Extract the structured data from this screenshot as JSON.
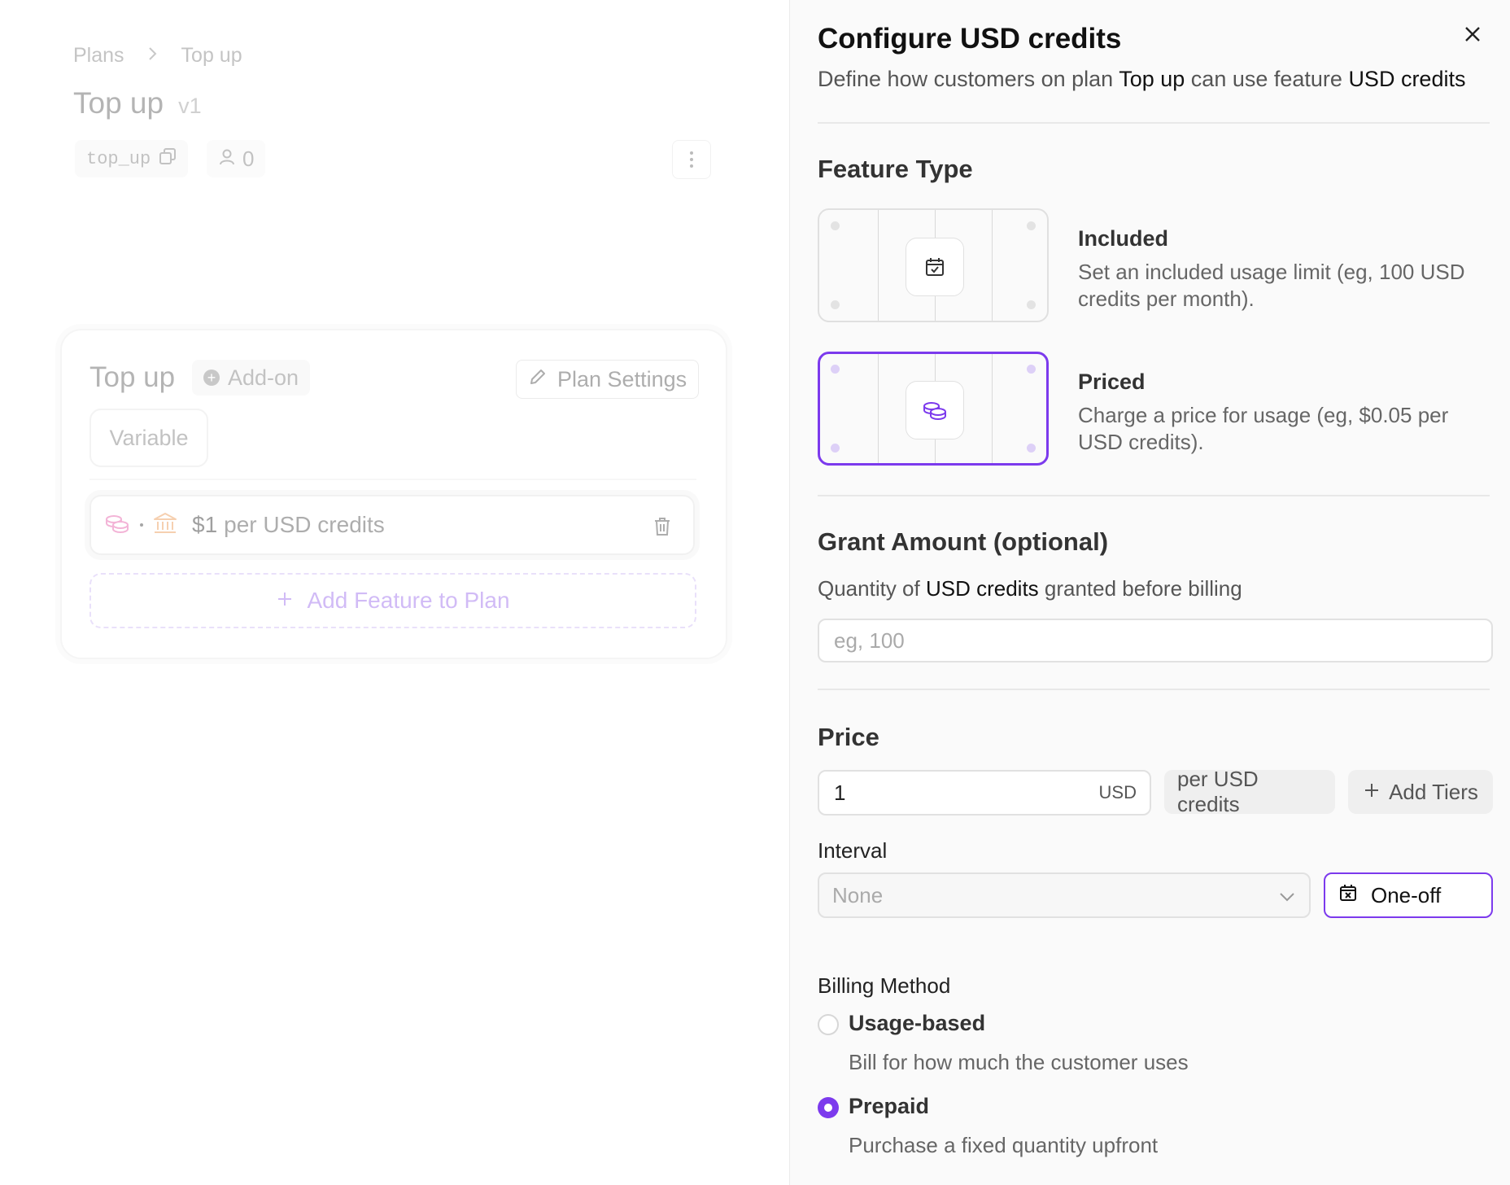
{
  "left": {
    "breadcrumb": [
      "Plans",
      "Top up"
    ],
    "plan_name": "Top up",
    "plan_version": "v1",
    "plan_id": "top_up",
    "customer_count": "0",
    "card": {
      "title": "Top up",
      "badge": "Add-on",
      "settings_label": "Plan Settings",
      "variant_chip": "Variable",
      "feature": {
        "amount": "$1",
        "rest": "per USD credits"
      },
      "add_feature_label": "Add Feature to Plan"
    }
  },
  "panel": {
    "title": "Configure USD credits",
    "desc": {
      "p1": "Define how customers on plan ",
      "plan": "Top up",
      "p2": " can use feature ",
      "feature": "USD credits"
    },
    "feature_type": {
      "title": "Feature Type",
      "options": [
        {
          "title": "Included",
          "desc": "Set an included usage limit (eg, 100 USD credits per month).",
          "icon": "calendar-check-icon",
          "selected": false
        },
        {
          "title": "Priced",
          "desc": "Charge a price for usage (eg, $0.05 per USD credits).",
          "icon": "coins-icon",
          "selected": true
        }
      ]
    },
    "grant": {
      "title": "Grant Amount (optional)",
      "hint": {
        "p1": "Quantity of ",
        "feature": "USD credits",
        "p2": " granted before billing"
      },
      "placeholder": "eg, 100",
      "value": ""
    },
    "price": {
      "title": "Price",
      "value": "1",
      "currency": "USD",
      "unit_label": "per USD credits",
      "add_tiers_label": "Add Tiers"
    },
    "interval": {
      "label": "Interval",
      "selected": "None",
      "one_off_label": "One-off"
    },
    "billing": {
      "label": "Billing Method",
      "options": [
        {
          "title": "Usage-based",
          "desc": "Bill for how much the customer uses",
          "checked": false
        },
        {
          "title": "Prepaid",
          "desc": "Purchase a fixed quantity upfront",
          "checked": true
        }
      ]
    }
  },
  "colors": {
    "accent": "#7c3aed",
    "coin_pink": "#e0459b",
    "bank_orange": "#e8893a"
  }
}
